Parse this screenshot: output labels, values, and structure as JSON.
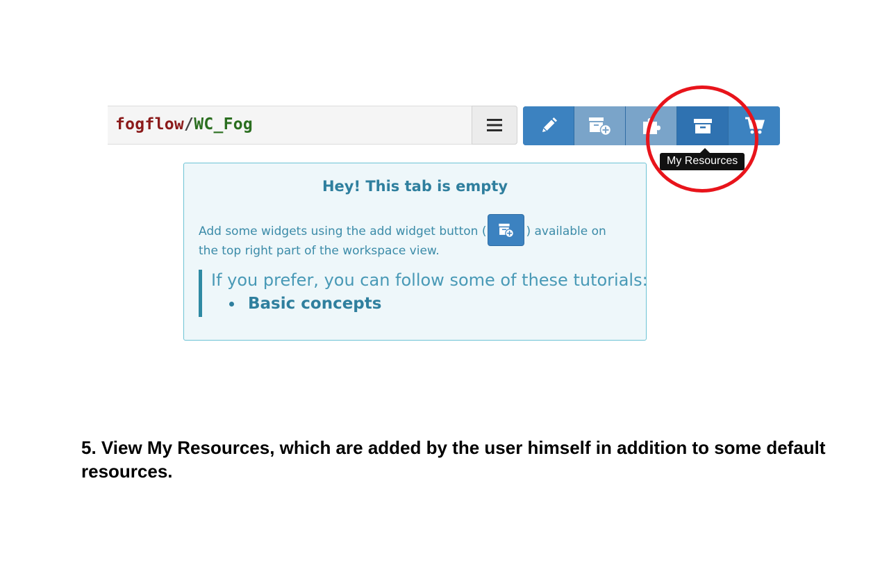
{
  "workspace": {
    "owner": "fogflow",
    "separator": "/",
    "name": "WC_Fog"
  },
  "toolbar": {
    "buttons": [
      {
        "id": "edit",
        "icon": "pencil-icon"
      },
      {
        "id": "add-widget",
        "icon": "add-widget-icon"
      },
      {
        "id": "wiring",
        "icon": "puzzle-icon"
      },
      {
        "id": "my-resources",
        "icon": "archive-icon"
      },
      {
        "id": "marketplace",
        "icon": "cart-icon"
      }
    ],
    "tooltip": "My Resources"
  },
  "empty_tab": {
    "heading": "Hey! This tab is empty",
    "line1_before": "Add some widgets using the add widget button (",
    "line1_after": ") available on",
    "line2": "the top right part of the workspace view.",
    "tutorials_intro": "If you prefer, you can follow some of these tutorials:",
    "tutorials": [
      "Basic concepts"
    ]
  },
  "caption": "5. View My Resources, which are added by the user himself in addition to some default resources.",
  "colors": {
    "accent": "#3c82c0",
    "highlight": "#e8141b",
    "info_text": "#31809e"
  }
}
